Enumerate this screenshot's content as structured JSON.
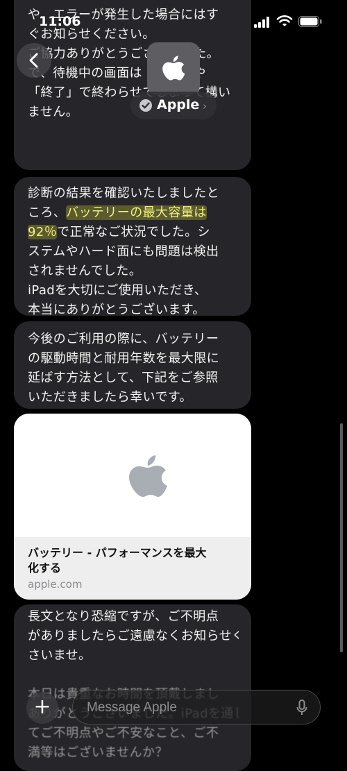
{
  "status_bar": {
    "time": "11:06"
  },
  "header": {
    "contact_name": "Apple"
  },
  "messages": [
    {
      "lines": [
        "や、エラーが発生した場合にはす",
        "ぐお知らせください。",
        "",
        "ご協力ありがとうございました。",
        "こちらに診断結果が届きましたので、",
        "で、待機中の画面は「完了」や",
        "「終了」で終わらせてしまって構い",
        "ません。"
      ]
    },
    {
      "lines": [
        "診断の結果を確認いたしましたと",
        "ころ、",
        "バッテリーの最大容量は",
        "92％",
        "で正常なご状況でした。シ",
        "ステムやハード面にも問題は検出",
        "されませんでした。",
        "iPadを大切にご使用いただき、",
        "本当にありがとうございます。"
      ]
    },
    {
      "lines": [
        "今後のご利用の際に、バッテリー",
        "の駆動時間と耐用年数を最大限に",
        "延ばす方法として、下記をご参照",
        "いただきましたら幸いです。"
      ]
    },
    {
      "lines": [
        "長文となり恐縮ですが、ご不明点",
        "がありましたらご遠慮なくお知らせくだ",
        "さいませ。",
        "",
        "本日は貴重なお時間を頂戴しまし",
        "ありがとうございました。iPadを通し",
        "てご不明点やご不安なこと、ご不",
        "満等はございませんか？"
      ]
    }
  ],
  "link_card": {
    "title_line1": "バッテリー - パフォーマンスを最大",
    "title_line2": "化する",
    "domain": "apple.com",
    "image_icon": "apple-logo-icon"
  },
  "composer": {
    "placeholder": "Message Apple"
  },
  "colors": {
    "bubble": "#26262a",
    "highlight": "#f4f27a",
    "background": "#000000"
  }
}
